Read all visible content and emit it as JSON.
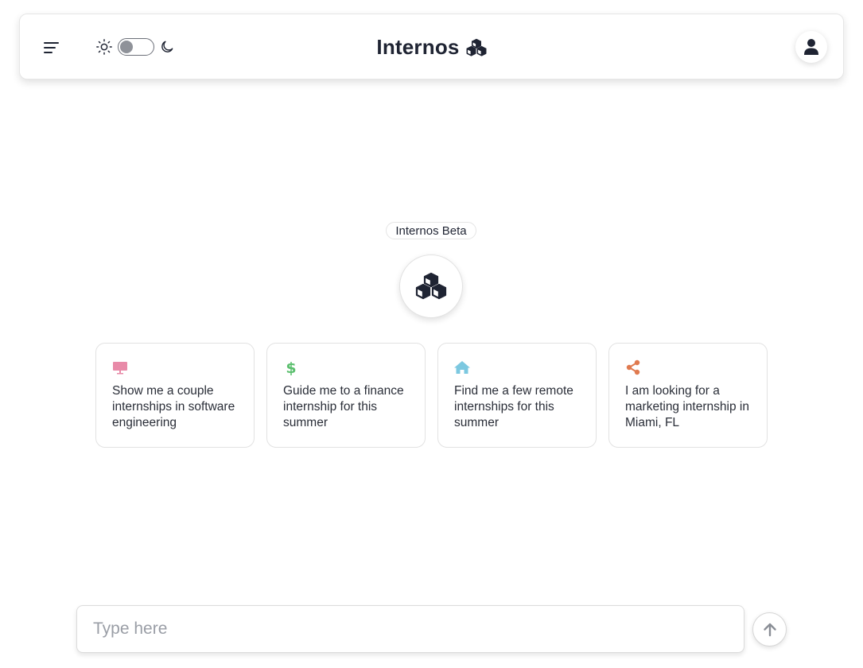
{
  "header": {
    "title": "Internos",
    "menu_icon": "hamburger-menu-icon",
    "theme": {
      "light_icon": "sun-icon",
      "dark_icon": "moon-icon",
      "dark_mode": false
    },
    "profile_icon": "user-icon"
  },
  "hero": {
    "badge": "Internos Beta",
    "logo_icon": "cubes-icon"
  },
  "suggestions": [
    {
      "icon": "monitor-icon",
      "color": "#e88aa8",
      "text": "Show me a couple internships in software engineering"
    },
    {
      "icon": "dollar-icon",
      "color": "#5bbf6e",
      "text": "Guide me to a finance internship for this summer"
    },
    {
      "icon": "home-icon",
      "color": "#7cc8e0",
      "text": "Find me a few remote internships for this summer"
    },
    {
      "icon": "share-icon",
      "color": "#e07a4f",
      "text": "I am looking for a marketing internship in Miami, FL"
    }
  ],
  "composer": {
    "placeholder": "Type here",
    "value": "",
    "send_icon": "arrow-up-icon"
  },
  "colors": {
    "primary": "#1f2433",
    "border": "#e2e2e2"
  }
}
